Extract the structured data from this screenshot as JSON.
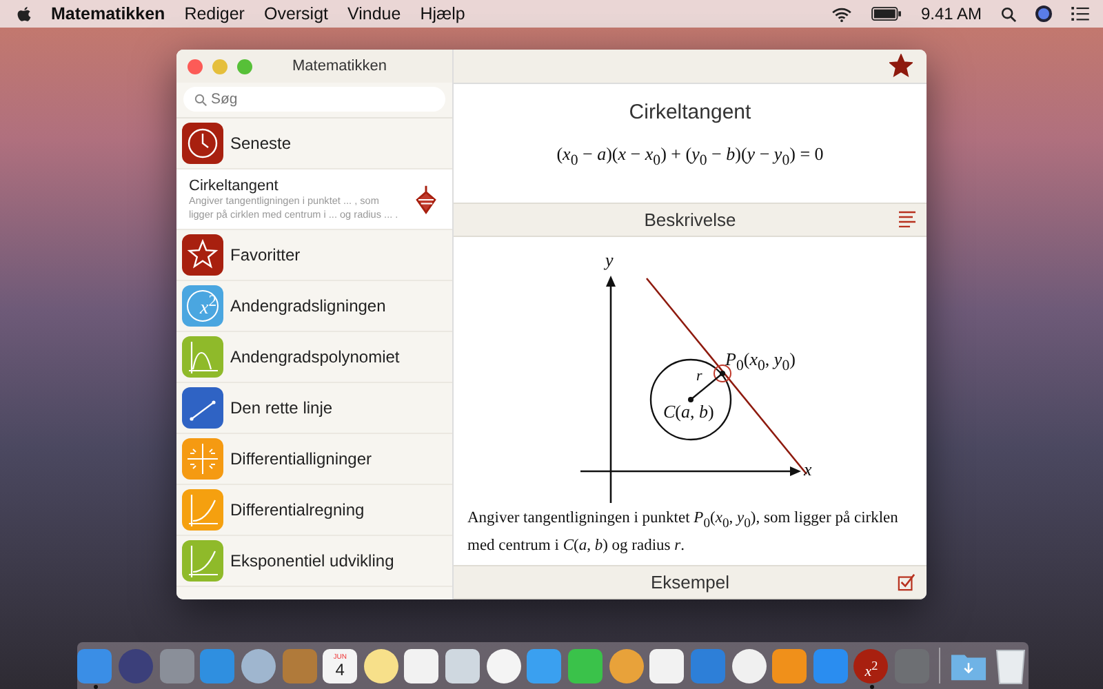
{
  "menu_bar": {
    "menus": [
      {
        "label": "Matematikken",
        "kind": "app"
      },
      {
        "label": "Rediger",
        "kind": "menu"
      },
      {
        "label": "Oversigt",
        "kind": "menu"
      },
      {
        "label": "Vindue",
        "kind": "menu"
      },
      {
        "label": "Hjælp",
        "kind": "menu"
      }
    ],
    "clock": "9.41 AM"
  },
  "window": {
    "title": "Matematikken",
    "search": {
      "placeholder": "Søg"
    },
    "sidebar": {
      "items": [
        {
          "kind": "category",
          "title": "Seneste",
          "color": "#a8200f",
          "selected": false
        },
        {
          "kind": "recent",
          "title": "Cirkeltangent",
          "description": "Angiver tangentligningen i punktet ... , som ligger på cirklen med centrum i ... og radius ... .",
          "selected": true
        },
        {
          "kind": "category",
          "title": "Favoritter",
          "color": "#a8200f",
          "selected": false
        },
        {
          "kind": "category",
          "title": "Andengradsligningen",
          "color": "#4aa6e0",
          "icon_text": "*x*$^{2}$",
          "selected": false
        },
        {
          "kind": "category",
          "title": "Andengradspolynomiet",
          "color": "#8fba2a",
          "selected": false
        },
        {
          "kind": "category",
          "title": "Den rette linje",
          "color": "#2f63c4",
          "selected": false
        },
        {
          "kind": "category",
          "title": "Differentialligninger",
          "color": "#f59a12",
          "selected": false
        },
        {
          "kind": "category",
          "title": "Differentialregning",
          "color": "#f5a00f",
          "selected": false
        },
        {
          "kind": "category",
          "title": "Eksponentiel udvikling",
          "color": "#8fba2a",
          "selected": false
        }
      ]
    },
    "detail": {
      "favorite": true,
      "title": "Cirkeltangent",
      "formula": "(*x*$_{0}$ − *a*)(*x* − *x*$_{0}$) + (*y*$_{0}$ − *b*)(*y* − *y*$_{0}$) = 0",
      "sections": [
        {
          "kind": "description",
          "heading": "Beskrivelse",
          "diagram_labels": [
            "*y*",
            "*x*",
            "*P*$_{0}$(*x*$_{0}$, *y*$_{0}$)",
            "*r*",
            "*C*(*a*, *b*)"
          ],
          "text": "Angiver tangentligningen i punktet *P*$_{0}$(*x*$_{0}$, *y*$_{0}$), som ligger på cirklen med centrum i *C*(*a*, *b*) og radius *r*."
        },
        {
          "kind": "example",
          "heading": "Eksempel"
        }
      ]
    }
  },
  "dock": {
    "items": [
      {
        "kind": "app",
        "color": "#3a8ee6",
        "running": true
      },
      {
        "kind": "app",
        "color": "#3b3f7a",
        "running": false
      },
      {
        "kind": "app",
        "color": "#8a8f99",
        "running": false
      },
      {
        "kind": "app",
        "color": "#2f8fe0",
        "running": false
      },
      {
        "kind": "app",
        "color": "#9fb6cf",
        "running": false
      },
      {
        "kind": "app",
        "color": "#b07a3a",
        "running": false
      },
      {
        "kind": "calendar",
        "color": "#f4f4f4",
        "month": "JUN",
        "day": "4",
        "running": false
      },
      {
        "kind": "app",
        "color": "#f7e08a",
        "running": false
      },
      {
        "kind": "app",
        "color": "#f2f2f2",
        "running": false
      },
      {
        "kind": "app",
        "color": "#cfd8e0",
        "running": false
      },
      {
        "kind": "app",
        "color": "#f4f4f4",
        "running": false
      },
      {
        "kind": "app",
        "color": "#3aa0f0",
        "running": false
      },
      {
        "kind": "app",
        "color": "#3ac24a",
        "running": false
      },
      {
        "kind": "app",
        "color": "#e8a23a",
        "running": false
      },
      {
        "kind": "app",
        "color": "#f2f2f2",
        "running": false
      },
      {
        "kind": "app",
        "color": "#2d7fd8",
        "running": false
      },
      {
        "kind": "app",
        "color": "#f0f0f0",
        "running": false
      },
      {
        "kind": "app",
        "color": "#f0901a",
        "running": false
      },
      {
        "kind": "app",
        "color": "#2a8df0",
        "running": false
      },
      {
        "kind": "math",
        "color": "#a8200f",
        "glyph": "*x*$^{2}$",
        "running": true
      },
      {
        "kind": "app",
        "color": "#6d6f73",
        "running": false
      },
      {
        "kind": "folder",
        "color": "#6fb3e6",
        "running": false
      },
      {
        "kind": "trash",
        "color": "#e8ecef",
        "running": false
      }
    ]
  }
}
